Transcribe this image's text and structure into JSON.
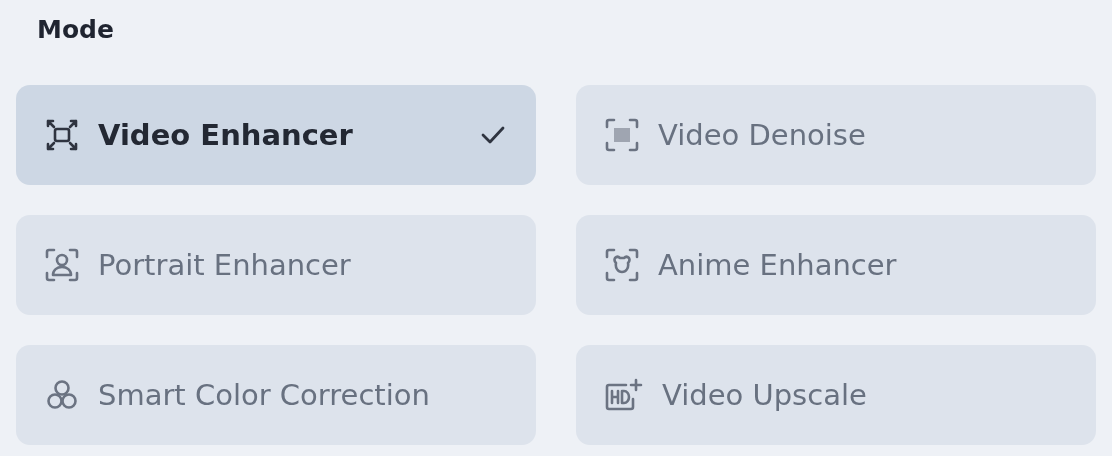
{
  "title": "Mode",
  "modes": [
    {
      "label": "Video Enhancer",
      "selected": true
    },
    {
      "label": "Video Denoise",
      "selected": false
    },
    {
      "label": "Portrait Enhancer",
      "selected": false
    },
    {
      "label": "Anime Enhancer",
      "selected": false
    },
    {
      "label": "Smart Color Correction",
      "selected": false
    },
    {
      "label": "Video Upscale",
      "selected": false
    }
  ]
}
